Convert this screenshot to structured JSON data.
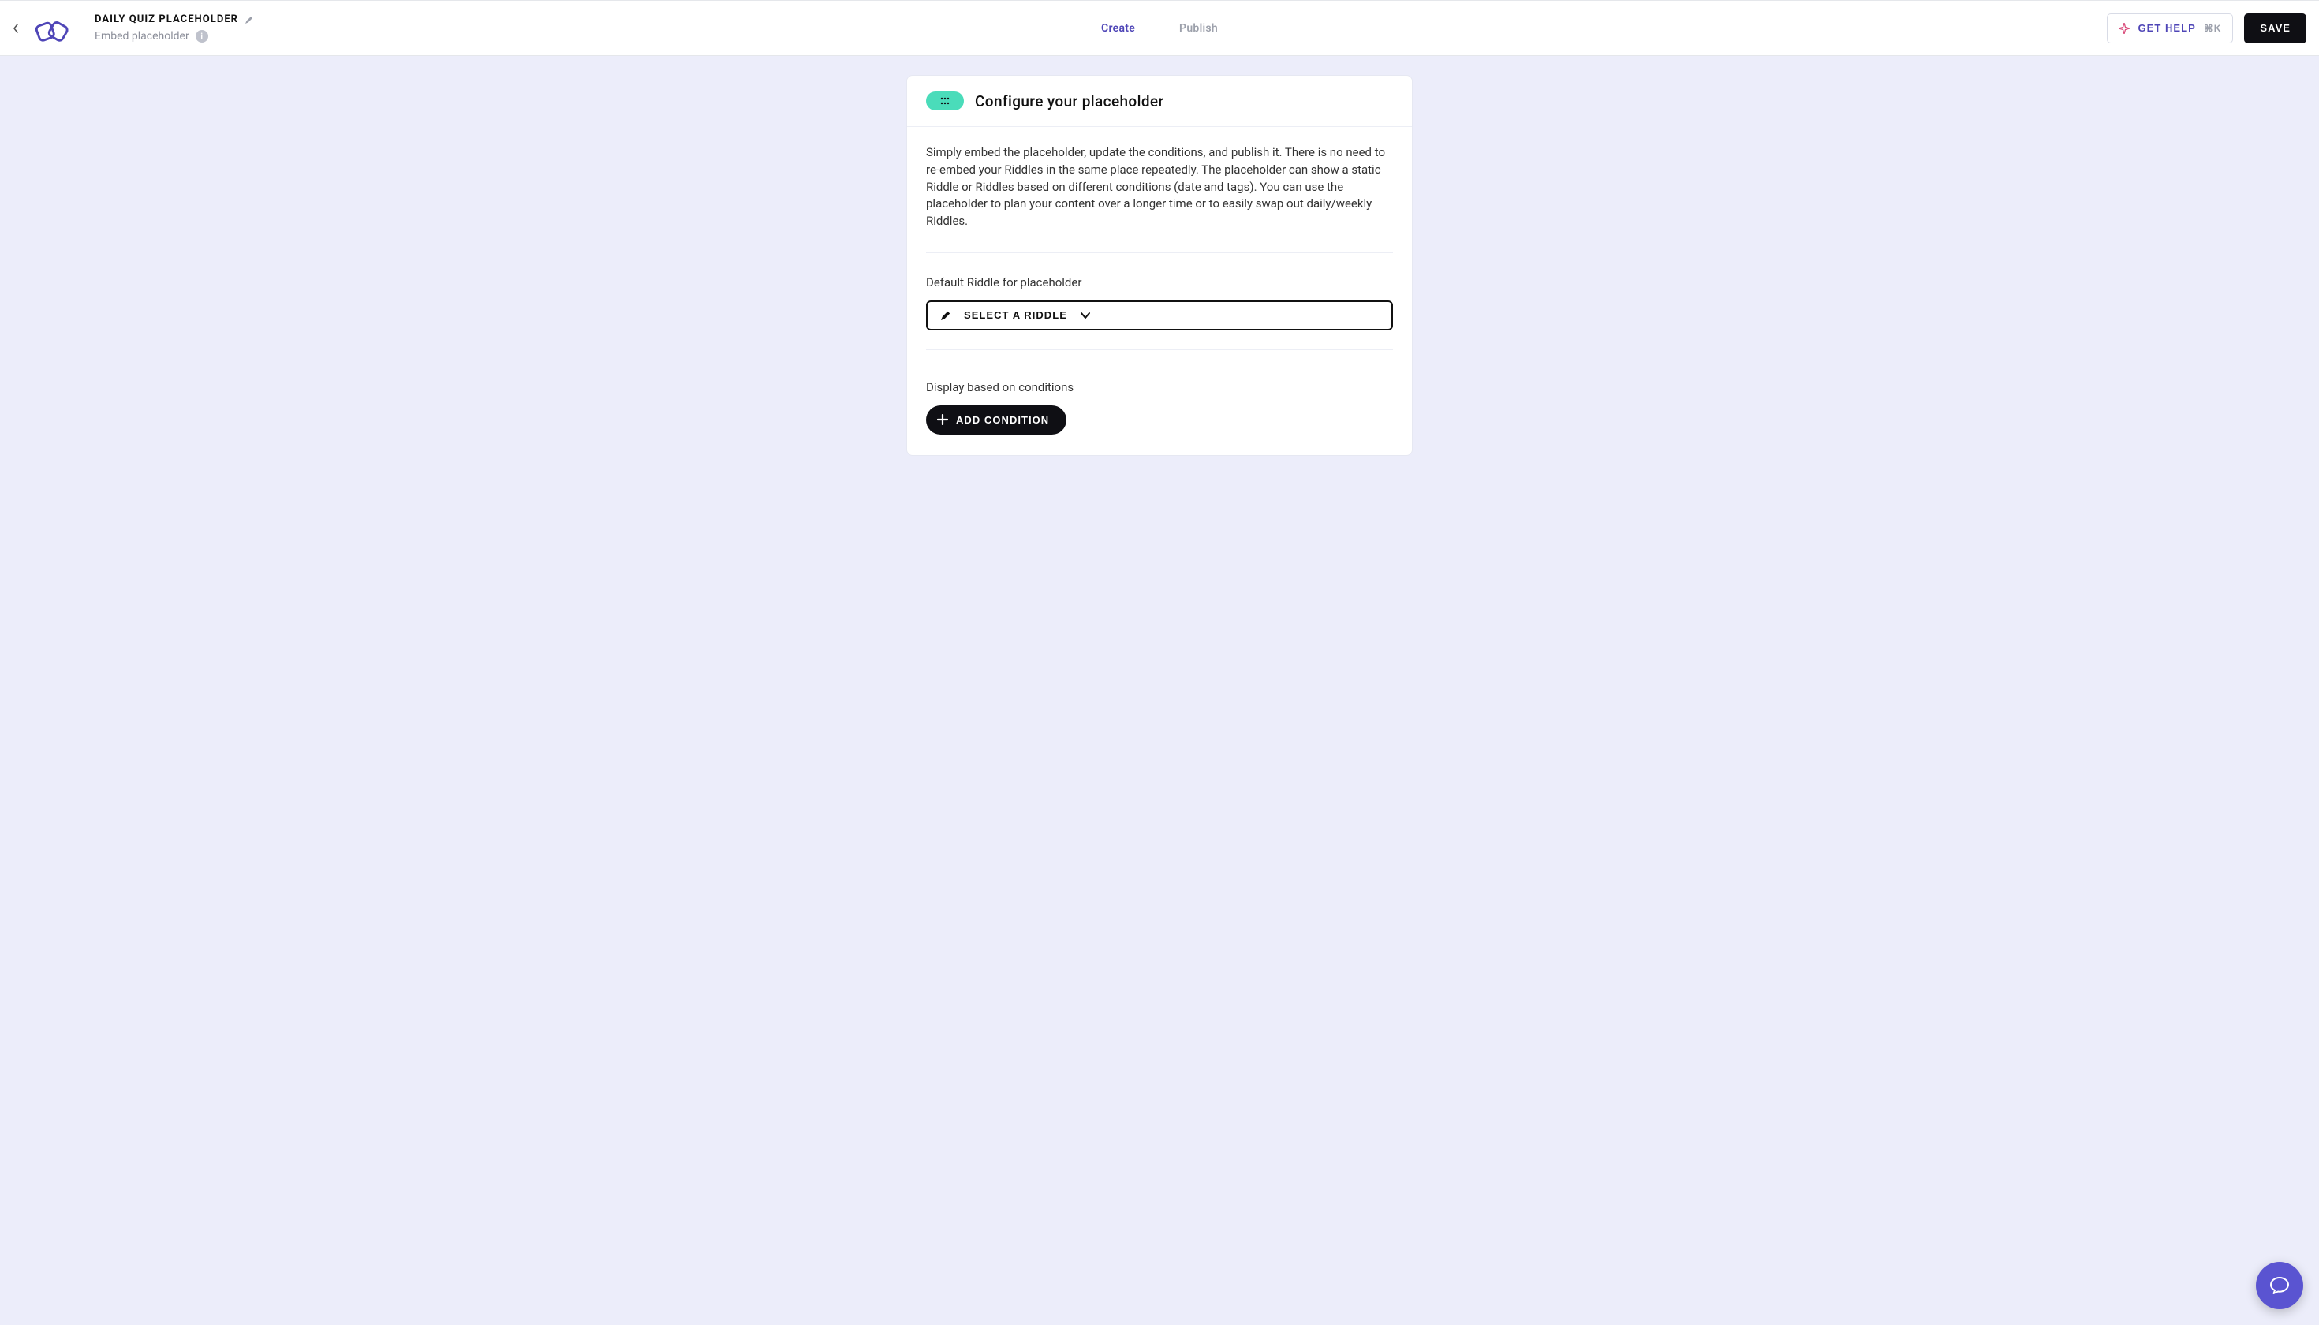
{
  "header": {
    "title": "DAILY QUIZ PLACEHOLDER",
    "subtitle": "Embed placeholder",
    "tabs": [
      {
        "label": "Create",
        "active": true
      },
      {
        "label": "Publish",
        "active": false
      }
    ],
    "help_label": "GET HELP",
    "help_shortcut": "⌘K",
    "save_label": "SAVE"
  },
  "card": {
    "title": "Configure your placeholder",
    "description": "Simply embed the placeholder, update the conditions, and publish it. There is no need to re-embed your Riddles in the same place repeatedly. The placeholder can show a static Riddle or Riddles based on different conditions (date and tags). You can use the placeholder to plan your content over a longer time or to easily swap out daily/weekly Riddles.",
    "default_label": "Default Riddle for placeholder",
    "select_riddle_label": "SELECT A RIDDLE",
    "conditions_label": "Display based on conditions",
    "add_condition_label": "ADD CONDITION"
  }
}
